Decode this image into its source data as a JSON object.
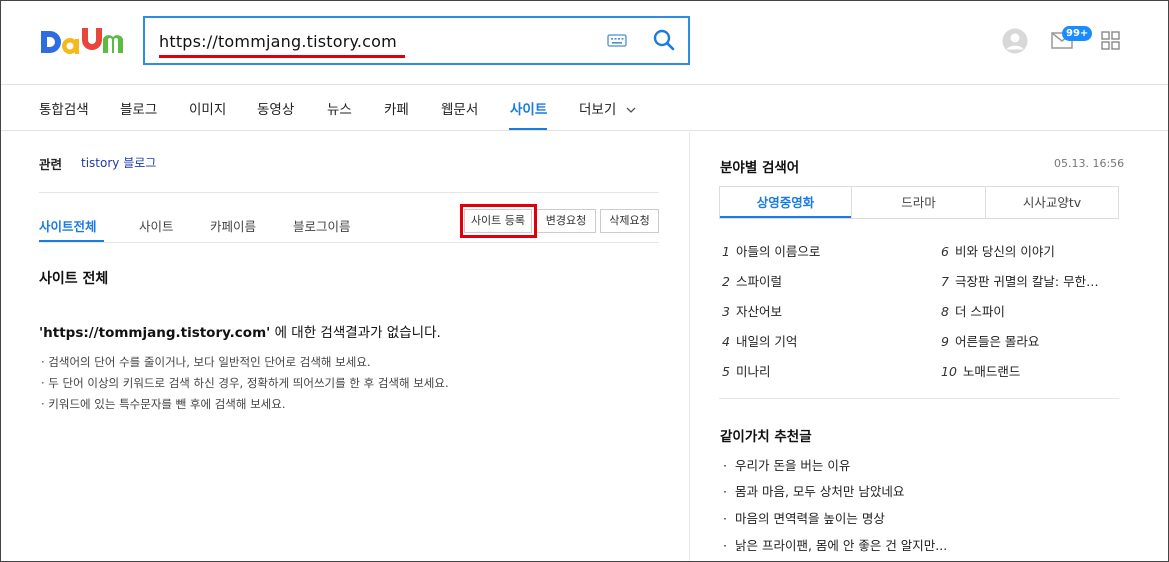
{
  "header": {
    "logo_text": "Daum",
    "search_value": "https://tommjang.tistory.com",
    "mail_badge": "99+"
  },
  "nav": {
    "items": [
      "통합검색",
      "블로그",
      "이미지",
      "동영상",
      "뉴스",
      "카페",
      "웹문서",
      "사이트",
      "더보기"
    ],
    "active": "사이트"
  },
  "related": {
    "label": "관련",
    "link": "tistory 블로그"
  },
  "subtabs": [
    "사이트전체",
    "사이트",
    "카페이름",
    "블로그이름"
  ],
  "buttons": {
    "register": "사이트 등록",
    "change": "변경요청",
    "delete": "삭제요청"
  },
  "main": {
    "section_title": "사이트 전체",
    "no_result_query": "'https://tommjang.tistory.com'",
    "no_result_suffix": " 에 대한 검색결과가 없습니다.",
    "tips": [
      "· 검색어의 단어 수를 줄이거나, 보다 일반적인 단어로 검색해 보세요.",
      "· 두 단어 이상의 키워드로 검색 하신 경우, 정확하게 띄어쓰기를 한 후 검색해 보세요.",
      "· 키워드에 있는 특수문자를 뺀 후에 검색해 보세요."
    ]
  },
  "trending": {
    "title": "분야별 검색어",
    "timestamp": "05.13. 16:56",
    "tabs": [
      "상영중영화",
      "드라마",
      "시사교양tv"
    ],
    "active_tab": "상영중영화",
    "ranks": [
      {
        "n": "1",
        "t": "아들의 이름으로"
      },
      {
        "n": "2",
        "t": "스파이럴"
      },
      {
        "n": "3",
        "t": "자산어보"
      },
      {
        "n": "4",
        "t": "내일의 기억"
      },
      {
        "n": "5",
        "t": "미나리"
      },
      {
        "n": "6",
        "t": "비와 당신의 이야기"
      },
      {
        "n": "7",
        "t": "극장판 귀멸의 칼날: 무한…"
      },
      {
        "n": "8",
        "t": "더 스파이"
      },
      {
        "n": "9",
        "t": "어른들은 몰라요"
      },
      {
        "n": "10",
        "t": "노매드랜드"
      }
    ]
  },
  "recommend": {
    "title": "같이가치 추천글",
    "items": [
      "우리가 돈을 버는 이유",
      "몸과 마음, 모두 상처만 남았네요",
      "마음의 면역력을 높이는 명상",
      "낡은 프라이팬, 몸에 안 좋은 건 알지만..."
    ]
  },
  "colors": {
    "accent": "#1a7ce0",
    "highlight_red": "#e0000b",
    "search_border": "#2b8ee0"
  }
}
